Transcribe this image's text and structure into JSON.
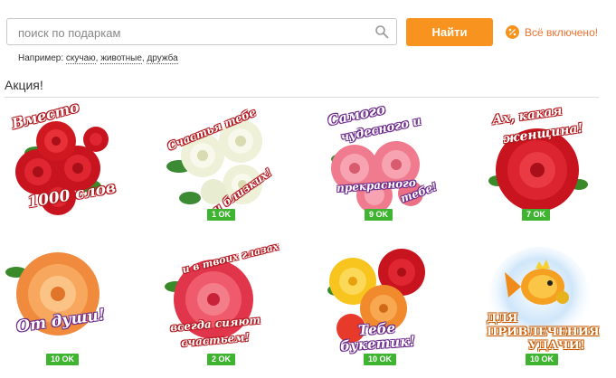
{
  "search": {
    "placeholder": "поиск по подаркам",
    "value": ""
  },
  "find_button": {
    "label": "Найти"
  },
  "promo": {
    "label": "Всё включено!"
  },
  "examples": {
    "prefix": "Например:",
    "items": [
      "скучаю",
      "животные",
      "дружба"
    ]
  },
  "section": {
    "title": "Акция!"
  },
  "colors": {
    "accent": "#f7931e",
    "badge": "#3fb431",
    "link": "#eb722e"
  },
  "gifts": [
    {
      "caption": [
        "Вместо",
        "1000 слов"
      ],
      "price": "",
      "icon": "red-roses-bouquet-icon"
    },
    {
      "caption": [
        "Счастья тебе",
        "и близких!"
      ],
      "price": "1 OK",
      "icon": "white-roses-icon"
    },
    {
      "caption": [
        "Самого",
        "чудесного и",
        "прекрасного",
        "тебе!"
      ],
      "price": "9 OK",
      "icon": "pink-roses-icon"
    },
    {
      "caption": [
        "Ах, какая",
        "женщина!"
      ],
      "price": "7 OK",
      "icon": "red-rose-icon"
    },
    {
      "caption": [
        "От души!"
      ],
      "price": "10 OK",
      "icon": "orange-rose-icon"
    },
    {
      "caption": [
        "и в твоих глазах",
        "всегда сияют",
        "счастьем!"
      ],
      "price": "2 OK",
      "icon": "pink-red-rose-icon"
    },
    {
      "caption": [
        "Тебе",
        "букетик!"
      ],
      "price": "10 OK",
      "icon": "mixed-roses-icon"
    },
    {
      "caption": [
        "ДЛЯ",
        "ПРИВЛЕЧЕНИЯ",
        "УДАЧИ!"
      ],
      "price": "10 OK",
      "icon": "goldfish-icon"
    }
  ]
}
